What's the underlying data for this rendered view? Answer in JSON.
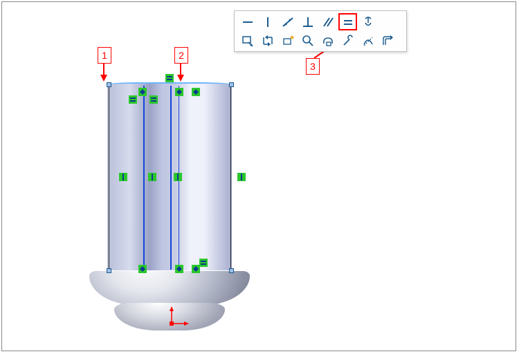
{
  "callouts": {
    "one": "1",
    "two": "2",
    "three": "3"
  },
  "toolbar": {
    "row1": [
      {
        "name": "horizontal-constraint-icon",
        "glyph": "horizontal"
      },
      {
        "name": "vertical-constraint-icon",
        "glyph": "vertical"
      },
      {
        "name": "collinear-constraint-icon",
        "glyph": "collinear"
      },
      {
        "name": "perpendicular-constraint-icon",
        "glyph": "perpendicular"
      },
      {
        "name": "parallel-constraint-icon",
        "glyph": "parallel"
      },
      {
        "name": "equal-constraint-icon",
        "glyph": "equal",
        "highlight": true
      },
      {
        "name": "fix-constraint-icon",
        "glyph": "fix"
      }
    ],
    "row2": [
      {
        "name": "quick-snap-icon",
        "glyph": "snap"
      },
      {
        "name": "swap-icon",
        "glyph": "swap"
      },
      {
        "name": "auto-constraint-icon",
        "glyph": "sparkle"
      },
      {
        "name": "zoom-icon",
        "glyph": "zoom"
      },
      {
        "name": "select-chain-icon",
        "glyph": "chain"
      },
      {
        "name": "repair-sketch-icon",
        "glyph": "repair"
      },
      {
        "name": "make-construction-icon",
        "glyph": "dashdiag"
      },
      {
        "name": "offset-entities-icon",
        "glyph": "offset"
      }
    ]
  },
  "colors": {
    "accent_blue": "#1a5b8f",
    "highlight_red": "#ff0000",
    "constraint_green": "#2bc72b",
    "sketch_blue": "#1244d8"
  }
}
